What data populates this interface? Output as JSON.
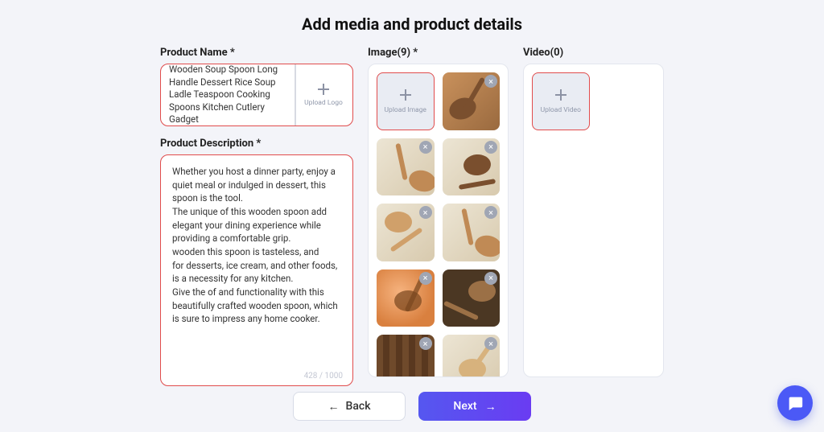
{
  "page": {
    "title": "Add media and product details"
  },
  "productName": {
    "label": "Product Name *",
    "value": "Wooden Soup Spoon Long Handle Dessert Rice Soup Ladle Teaspoon Cooking Spoons Kitchen Cutlery Gadget",
    "uploadLogoLabel": "Upload Logo"
  },
  "productDescription": {
    "label": "Product Description *",
    "value": "Whether you host a dinner party, enjoy a quiet meal or indulged in dessert, this spoon is the tool.\nThe unique of this wooden spoon add elegant your dining experience while providing a comfortable grip.\nwooden this spoon is tasteless, and\nfor desserts, ice cream, and other foods, is a necessity for any kitchen.\nGive the of and functionality with this beautifully crafted wooden spoon, which is sure to impress any home cooker.",
    "counter": "428 / 1000"
  },
  "image": {
    "label": "Image(9) *",
    "uploadLabel": "Upload Image",
    "count": 9
  },
  "video": {
    "label": "Video(0)",
    "uploadLabel": "Upload Video",
    "count": 0
  },
  "footer": {
    "backLabel": "Back",
    "nextLabel": "Next"
  }
}
